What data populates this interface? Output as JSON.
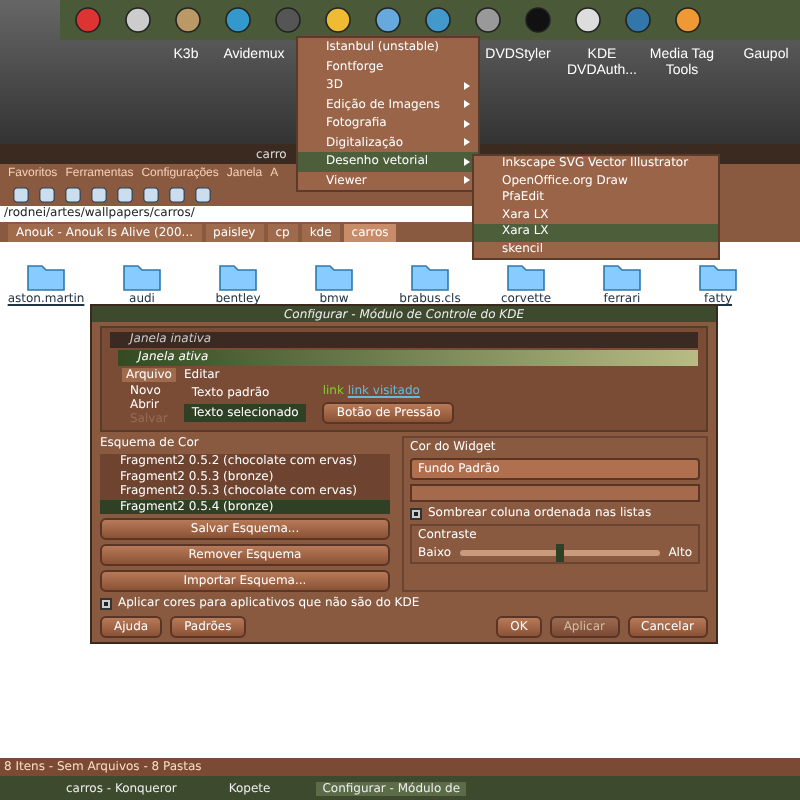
{
  "desktop_icons": [
    {
      "label": "K3b"
    },
    {
      "label": "Avidemux"
    },
    {
      "label": "DVDStyler"
    },
    {
      "label": "KDE DVDAuth..."
    },
    {
      "label": "Media Tag Tools"
    },
    {
      "label": "Gaupol"
    }
  ],
  "konqueror": {
    "title": "carro",
    "menu": [
      "Favoritos",
      "Ferramentas",
      "Configurações",
      "Janela",
      "A"
    ],
    "location": "/rodnei/artes/wallpapers/carros/",
    "tabs": [
      {
        "label": "Anouk - Anouk Is Alive (200...",
        "selected": false
      },
      {
        "label": "paisley",
        "selected": false
      },
      {
        "label": "cp",
        "selected": false
      },
      {
        "label": "kde",
        "selected": false
      },
      {
        "label": "carros",
        "selected": true
      }
    ],
    "files": [
      "aston.martin",
      "audi",
      "bentley",
      "bmw",
      "brabus.cls",
      "corvette",
      "ferrari",
      "fatty"
    ],
    "status": "8 Itens - Sem Arquivos - 8 Pastas"
  },
  "app_menu": {
    "items": [
      {
        "label": "Istanbul (unstable)",
        "submenu": false,
        "selected": false
      },
      {
        "label": "Fontforge",
        "submenu": false,
        "selected": false
      },
      {
        "label": "3D",
        "submenu": true,
        "selected": false
      },
      {
        "label": "Edição de Imagens",
        "submenu": true,
        "selected": false
      },
      {
        "label": "Fotografia",
        "submenu": true,
        "selected": false
      },
      {
        "label": "Digitalização",
        "submenu": true,
        "selected": false
      },
      {
        "label": "Desenho vetorial",
        "submenu": true,
        "selected": true
      },
      {
        "label": "Viewer",
        "submenu": true,
        "selected": false
      }
    ]
  },
  "submenu": {
    "items": [
      {
        "label": "Inkscape SVG Vector Illustrator",
        "selected": false
      },
      {
        "label": "OpenOffice.org Draw",
        "selected": false
      },
      {
        "label": "PfaEdit",
        "selected": false
      },
      {
        "label": "Xara LX",
        "selected": false
      },
      {
        "label": "Xara LX",
        "selected": true
      },
      {
        "label": "skencil",
        "selected": false
      }
    ]
  },
  "dialog": {
    "title": "Configurar - Módulo de Controle do KDE",
    "preview": {
      "inactive_title": "Janela inativa",
      "active_title": "Janela ativa",
      "menu": [
        "Arquivo",
        "Editar"
      ],
      "menu_items": [
        {
          "label": "Novo",
          "disabled": false
        },
        {
          "label": "Abrir",
          "disabled": false
        },
        {
          "label": "Salvar",
          "disabled": true
        }
      ],
      "normal_text": "Texto padrão",
      "selected_text": "Texto selecionado",
      "link": "link",
      "visited_link": "link visitado",
      "push_button": "Botão de Pressão"
    },
    "scheme_group": "Esquema de Cor",
    "schemes": [
      {
        "label": "Fragment2 0.5.2 (chocolate com ervas)",
        "selected": false
      },
      {
        "label": "Fragment2 0.5.3 (bronze)",
        "selected": false
      },
      {
        "label": "Fragment2 0.5.3 (chocolate com ervas)",
        "selected": false
      },
      {
        "label": "Fragment2 0.5.4 (bronze)",
        "selected": true
      }
    ],
    "scheme_buttons": [
      "Salvar Esquema...",
      "Remover Esquema",
      "Importar Esquema..."
    ],
    "widget_group": "Cor do Widget",
    "widget_choice": "Fundo Padrão",
    "shade_sorted": {
      "label": "Sombrear coluna ordenada nas listas",
      "checked": true
    },
    "contrast": {
      "title": "Contraste",
      "low": "Baixo",
      "high": "Alto",
      "level": 0.5
    },
    "apply_non_kde": {
      "label": "Aplicar cores para aplicativos que não são do KDE",
      "checked": true
    },
    "buttons": [
      {
        "label": "Ajuda",
        "disabled": false
      },
      {
        "label": "Padrões",
        "disabled": false
      },
      {
        "label": "OK",
        "disabled": false
      },
      {
        "label": "Aplicar",
        "disabled": true
      },
      {
        "label": "Cancelar",
        "disabled": false
      }
    ]
  },
  "taskbar": {
    "items": [
      {
        "label": "carros - Konqueror",
        "selected": false
      },
      {
        "label": "Kopete",
        "selected": false
      },
      {
        "label": "Configurar - Módulo de",
        "selected": true
      }
    ]
  }
}
